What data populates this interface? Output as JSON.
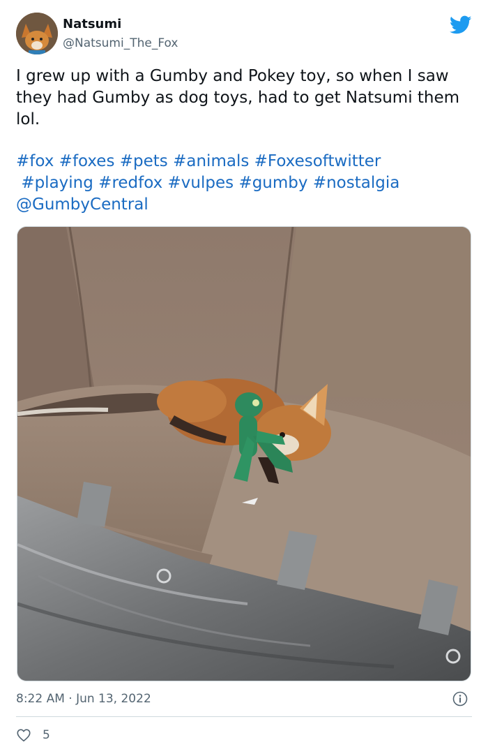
{
  "author": {
    "display_name": "Natsumi",
    "handle": "@Natsumi_The_Fox",
    "avatar_icon": "fox-avatar"
  },
  "platform_icon": "twitter-bird-icon",
  "tweet": {
    "text": "I grew up with a Gumby and Pokey toy, so when I saw they had Gumby as dog toys, had to get Natsumi them lol.",
    "hashtags": [
      "#fox",
      "#foxes",
      "#pets",
      "#animals",
      "#Foxesoftwitter",
      "#playing",
      "#redfox",
      "#vulpes",
      "#gumby",
      "#nostalgia"
    ],
    "mention": "@GumbyCentral"
  },
  "meta": {
    "timestamp": "8:22 AM · Jun 13, 2022"
  },
  "engagement": {
    "likes": "5"
  },
  "colors": {
    "link": "#1a6bc2",
    "twitter_blue": "#1d9bf0",
    "secondary_text": "#536471"
  }
}
